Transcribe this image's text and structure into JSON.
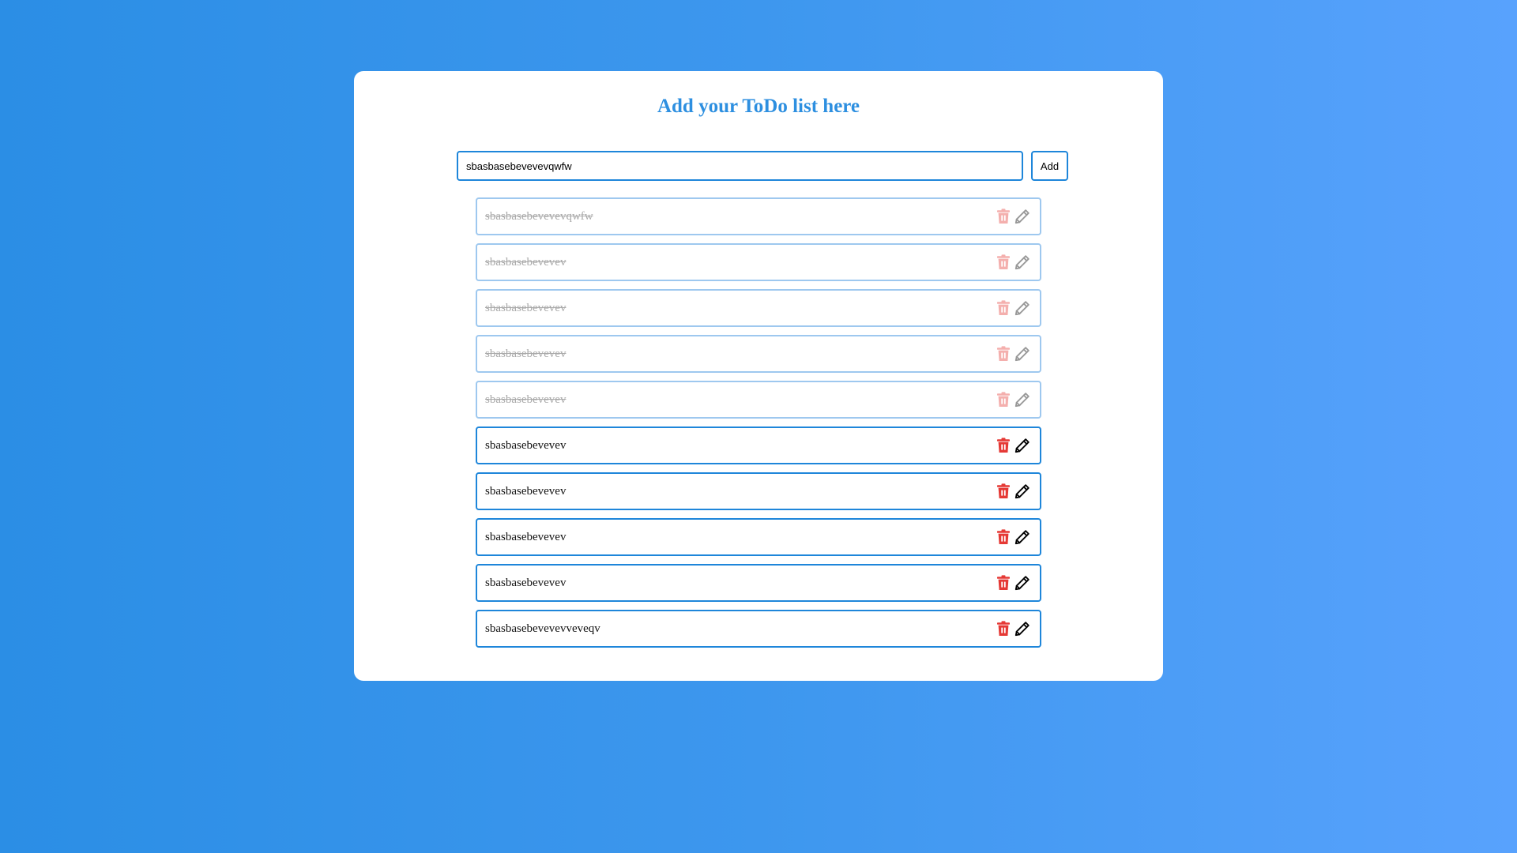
{
  "page": {
    "title": "Add your ToDo list here"
  },
  "new_todo": {
    "value": "sbasbasebevevevqwfw",
    "add_label": "Add"
  },
  "colors": {
    "accent": "#1e86da",
    "delete": "#e53935",
    "done_text": "#a9a9a9"
  },
  "icons": {
    "delete": "trash-icon",
    "edit": "pencil-icon"
  },
  "todos": [
    {
      "text": "sbasbasebevevevqwfw",
      "completed": true
    },
    {
      "text": "sbasbasebevevev",
      "completed": true
    },
    {
      "text": "sbasbasebevevev",
      "completed": true
    },
    {
      "text": "sbasbasebevevev",
      "completed": true
    },
    {
      "text": "sbasbasebevevev",
      "completed": true
    },
    {
      "text": "sbasbasebevevev",
      "completed": false
    },
    {
      "text": "sbasbasebevevev",
      "completed": false
    },
    {
      "text": "sbasbasebevevev",
      "completed": false
    },
    {
      "text": "sbasbasebevevev",
      "completed": false
    },
    {
      "text": "sbasbasebevevevveveqv",
      "completed": false
    }
  ]
}
